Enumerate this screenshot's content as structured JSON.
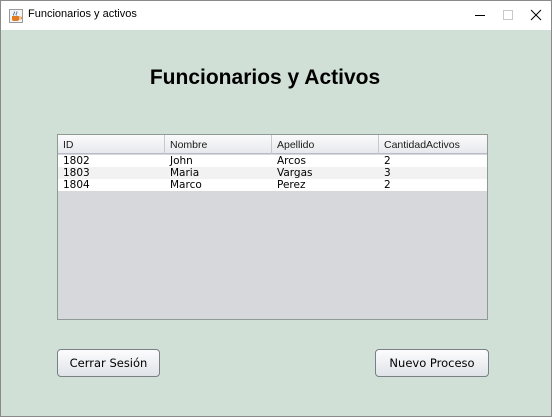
{
  "window": {
    "title": "Funcionarios y activos",
    "icon": "java-cup-icon"
  },
  "heading": "Funcionarios y Activos",
  "table": {
    "columns": [
      "ID",
      "Nombre",
      "Apellido",
      "CantidadActivos"
    ],
    "rows": [
      [
        "1802",
        "John",
        "Arcos",
        "2"
      ],
      [
        "1803",
        "Maria",
        "Vargas",
        "3"
      ],
      [
        "1804",
        "Marco",
        "Perez",
        "2"
      ]
    ]
  },
  "buttons": {
    "logout": "Cerrar Sesión",
    "new_process": "Nuevo Proceso"
  },
  "colors": {
    "panel_background": "#d1e0d6",
    "table_empty_area": "#d6d8dc"
  }
}
